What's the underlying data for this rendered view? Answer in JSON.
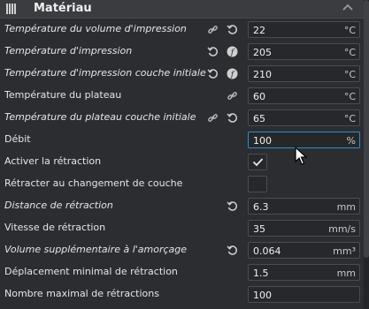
{
  "header": {
    "title": "Matériau",
    "icon": "material-icon",
    "chevron": "chevron-up-icon"
  },
  "rows": [
    {
      "label": "Température du volume d'impression",
      "italic": true,
      "icons": [
        "link-icon",
        "reset-icon"
      ],
      "value": "22",
      "unit": "°C"
    },
    {
      "label": "Température d'impression",
      "italic": true,
      "icons": [
        "reset-icon",
        "function-icon"
      ],
      "value": "205",
      "unit": "°C"
    },
    {
      "label": "Température d'impression couche initiale",
      "italic": true,
      "icons": [
        "reset-icon",
        "function-icon"
      ],
      "value": "210",
      "unit": "°C"
    },
    {
      "label": "Température du plateau",
      "italic": false,
      "icons": [
        "link-icon"
      ],
      "value": "60",
      "unit": "°C"
    },
    {
      "label": "Température du plateau couche initiale",
      "italic": true,
      "icons": [
        "link-icon",
        "reset-icon"
      ],
      "value": "65",
      "unit": "°C"
    },
    {
      "label": "Débit",
      "italic": false,
      "icons": [],
      "value": "100",
      "unit": "%"
    },
    {
      "label": "Activer la rétraction",
      "italic": false,
      "checkbox": true,
      "checked": true
    },
    {
      "label": "Rétracter au changement de couche",
      "italic": false,
      "checkbox": true,
      "checked": false
    },
    {
      "label": "Distance de rétraction",
      "italic": true,
      "icons": [
        "reset-icon"
      ],
      "value": "6.3",
      "unit": "mm"
    },
    {
      "label": "Vitesse de rétraction",
      "italic": false,
      "icons": [],
      "value": "35",
      "unit": "mm/s"
    },
    {
      "label": "Volume supplémentaire à l'amorçage",
      "italic": true,
      "icons": [
        "reset-icon"
      ],
      "value": "0.064",
      "unit": "mm³"
    },
    {
      "label": "Déplacement minimal de rétraction",
      "italic": false,
      "icons": [],
      "value": "1.5",
      "unit": "mm"
    },
    {
      "label": "Nombre maximal de rétractions",
      "italic": false,
      "icons": [],
      "value": "100",
      "unit": ""
    }
  ],
  "colors": {
    "accent": "#2f8fd3",
    "panel": "#2b2d30",
    "header": "#3a3c40"
  }
}
